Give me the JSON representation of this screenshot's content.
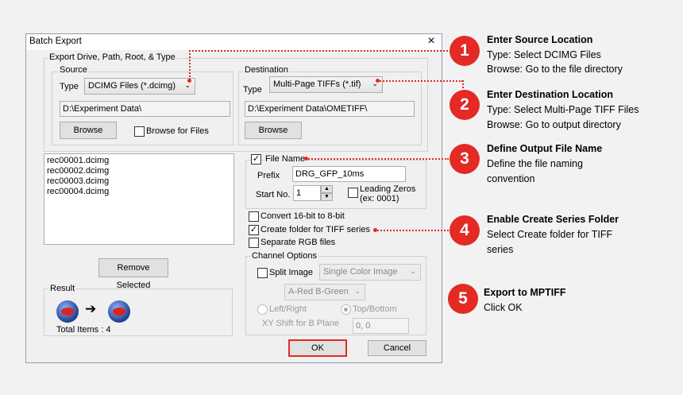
{
  "dialog": {
    "title": "Batch Export",
    "close_glyph": "×",
    "export_group_label": "Export Drive, Path, Root, & Type",
    "source": {
      "label": "Source",
      "type_label": "Type",
      "type_value": "DCIMG Files (*.dcimg)",
      "path": "D:\\Experiment Data\\",
      "browse_label": "Browse",
      "browse_files_label": "Browse for Files"
    },
    "destination": {
      "label": "Destination",
      "type_label": "Type",
      "type_value": "Multi-Page TIFFs (*.tif)",
      "path": "D:\\Experiment Data\\OMETIFF\\",
      "browse_label": "Browse"
    },
    "files": [
      "rec00001.dcimg",
      "rec00002.dcimg",
      "rec00003.dcimg",
      "rec00004.dcimg"
    ],
    "remove_selected_label": "Remove Selected",
    "result": {
      "label": "Result",
      "arrow_glyph": "➔",
      "total_items": "Total Items : 4"
    },
    "file_name": {
      "label": "File Name",
      "prefix_label": "Prefix",
      "prefix_value": "DRG_GFP_10ms",
      "start_no_label": "Start No.",
      "start_no_value": "1",
      "leading_zeros_label": "Leading Zeros",
      "leading_zeros_example": "(ex: 0001)"
    },
    "options": {
      "convert_label": "Convert 16-bit to 8-bit",
      "create_folder_label": "Create folder for TIFF series",
      "separate_rgb_label": "Separate RGB files"
    },
    "channel": {
      "label": "Channel Options",
      "split_image_label": "Split Image",
      "split_mode": "Single Color Image",
      "color_mode": "A-Red B-Green",
      "left_right_label": "Left/Right",
      "top_bottom_label": "Top/Bottom",
      "xy_shift_label": "XY Shift for B Plane",
      "xy_shift_value": "0, 0"
    },
    "ok_label": "OK",
    "cancel_label": "Cancel"
  },
  "annotations": [
    {
      "number": "1",
      "title": "Enter Source Location",
      "lines": [
        "Type: Select DCIMG Files",
        "Browse: Go to the file directory"
      ]
    },
    {
      "number": "2",
      "title": "Enter Destination Location",
      "lines": [
        "Type: Select Multi-Page TIFF Files",
        "Browse: Go to output directory"
      ]
    },
    {
      "number": "3",
      "title": "Define Output File Name",
      "lines": [
        "Define the file naming",
        "convention"
      ]
    },
    {
      "number": "4",
      "title": "Enable Create Series Folder",
      "lines": [
        "Select Create folder for TIFF",
        "series"
      ]
    },
    {
      "number": "5",
      "title": "Export to MPTIFF",
      "lines": [
        "Click OK"
      ]
    }
  ],
  "colors": {
    "accent": "#e32a25",
    "dialog_border": "#8a9fb8"
  }
}
